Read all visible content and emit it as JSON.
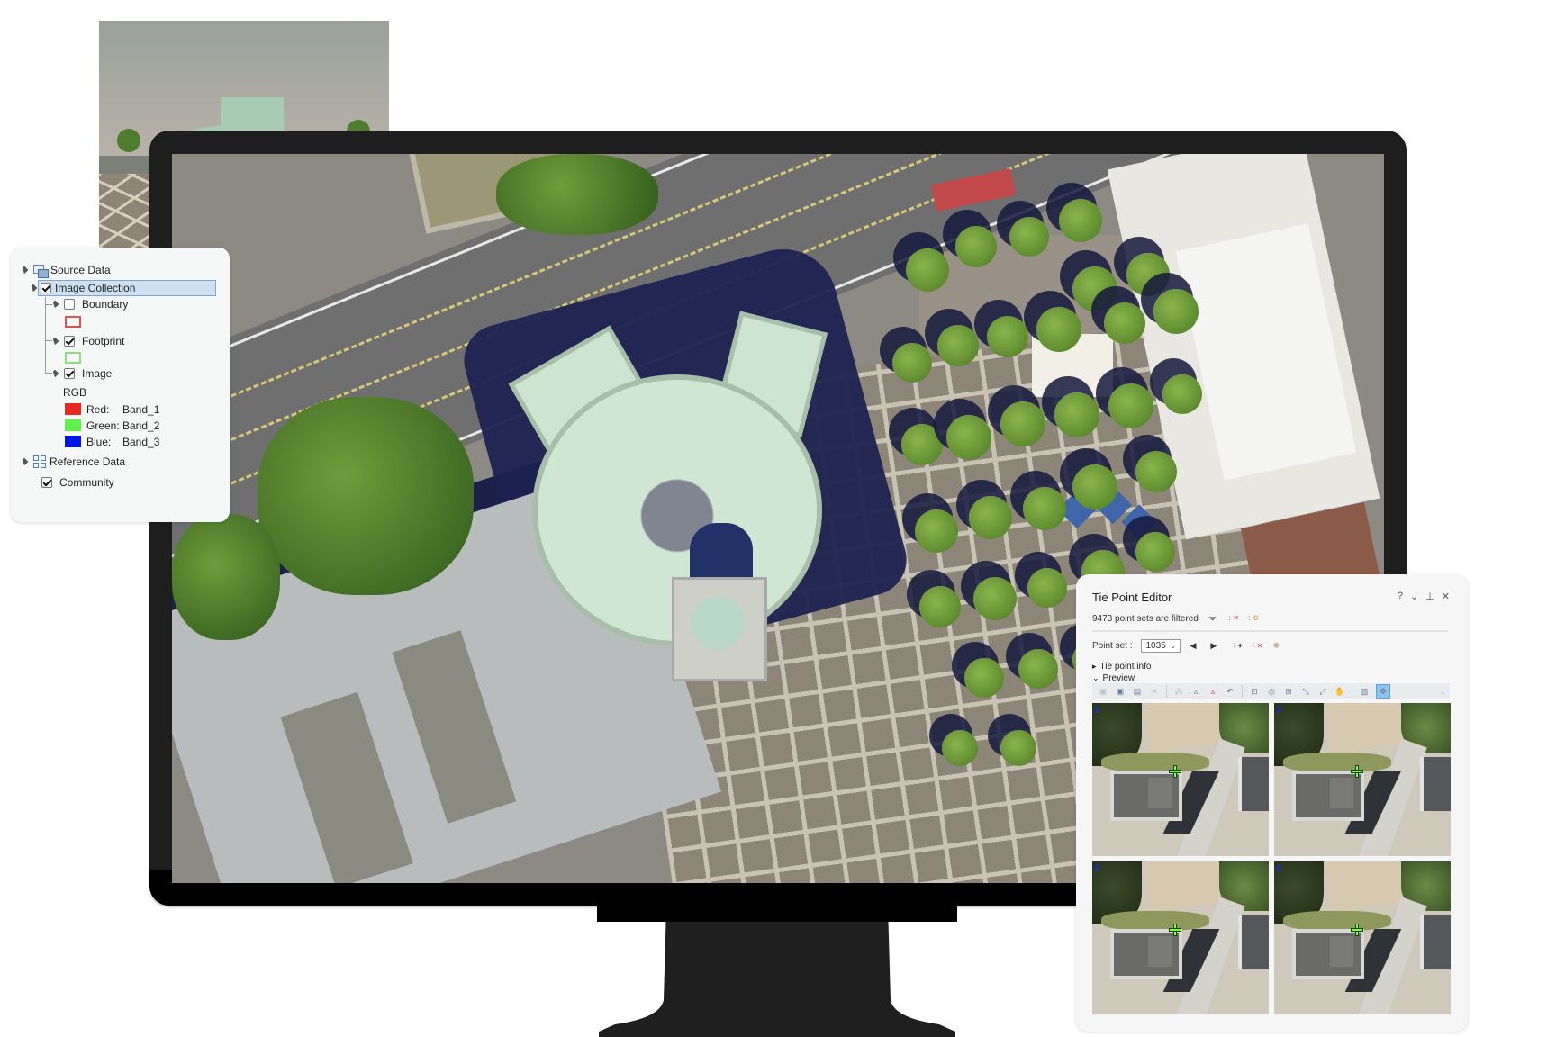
{
  "layer_panel": {
    "source_data": "Source Data",
    "image_collection": "Image Collection",
    "boundary": "Boundary",
    "boundary_color": "#d9534f",
    "footprint": "Footprint",
    "footprint_color": "#88e07a",
    "image": "Image",
    "rgb_label": "RGB",
    "bands": [
      {
        "label": "Red:",
        "band": "Band_1",
        "color": "#e8291f"
      },
      {
        "label": "Green:",
        "band": "Band_2",
        "color": "#5ff04a"
      },
      {
        "label": "Blue:",
        "band": "Band_3",
        "color": "#0014e6"
      }
    ],
    "reference_data": "Reference Data",
    "community": "Community",
    "checked": {
      "image_collection": true,
      "boundary": false,
      "footprint": true,
      "image": true,
      "community": true
    }
  },
  "tie_point_editor": {
    "title": "Tie Point Editor",
    "window_controls": {
      "help": "?",
      "menu": "⌄",
      "pin": "⊥",
      "close": "✕"
    },
    "filter_status": "9473 point sets are filtered",
    "point_set_label": "Point set :",
    "point_set_value": "1035",
    "sections": {
      "tie_point_info": "Tie point info",
      "preview": "Preview"
    },
    "preview_tiles": [
      {
        "number": "1"
      },
      {
        "number": "3"
      },
      {
        "number": "2"
      },
      {
        "number": "4"
      }
    ]
  },
  "icons": {
    "expand": "▸",
    "collapse": "⌄",
    "prev": "◀",
    "next": "▶",
    "chevron_down": "⌄"
  }
}
